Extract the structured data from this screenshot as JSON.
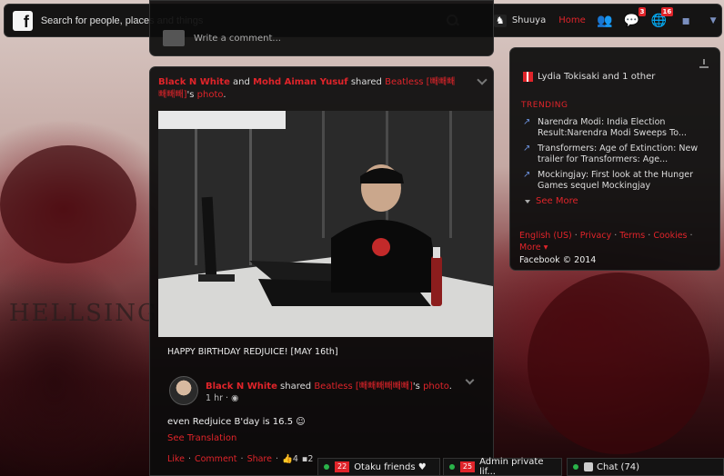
{
  "background": {
    "text": "HELLSING"
  },
  "topbar": {
    "search_placeholder": "Search for people, places and things",
    "user_name": "Shuuya",
    "home_label": "Home",
    "friend_requests": "",
    "messages_count": "3",
    "notifications_count": "16"
  },
  "prev_card": {
    "write_comment": "Write a comment..."
  },
  "post": {
    "actor1": "Black N White",
    "and_text": "and",
    "actor2": "Mohd Aiman Yusuf",
    "shared_text": "shared",
    "page_name": "Beatless [빼빼빼빼빼빼]",
    "possessive": "'s",
    "photo_link": "photo",
    "caption": "HAPPY BIRTHDAY REDJUICE! [MAY 16th]",
    "shared_by": "Black N White",
    "time": "1 hr",
    "status": "even Redjuice B'day is 16.5 ☺",
    "see_translation": "See Translation",
    "like": "Like",
    "comment": "Comment",
    "share": "Share",
    "likes_count": "4",
    "comments_count": "2"
  },
  "right": {
    "event": "Lydia Tokisaki and 1 other",
    "trending_label": "TRENDING",
    "trends": [
      "Narendra Modi: India Election Result:Narendra Modi Sweeps To...",
      "Transformers: Age of Extinction: New trailer for Transformers: Age...",
      "Mockingjay: First look at the Hunger Games sequel Mockingjay"
    ],
    "see_more": "See More",
    "links": [
      "English (US)",
      "Privacy",
      "Terms",
      "Cookies",
      "More"
    ],
    "copyright": "Facebook © 2014"
  },
  "chat": {
    "tab1_count": "22",
    "tab1_label": "Otaku friends ♥",
    "tab2_count": "25",
    "tab2_label": "Admin private lif...",
    "main_label": "Chat (74)"
  },
  "colors": {
    "accent": "#e0242a",
    "panel": "#0c0c0c",
    "online": "#2ab34a"
  }
}
